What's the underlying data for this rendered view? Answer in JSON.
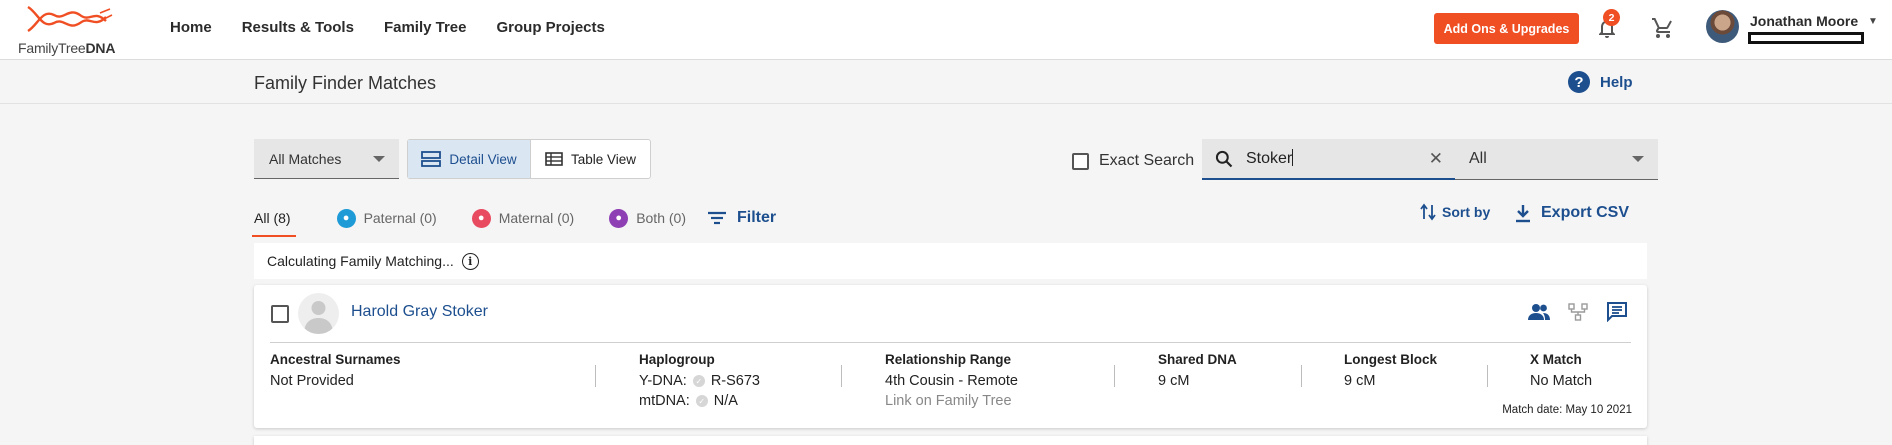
{
  "brand": {
    "name_light": "FamilyTree",
    "name_bold": "DNA",
    "accent": "#f04e23",
    "link_color": "#1d4f8f"
  },
  "nav": {
    "items": [
      "Home",
      "Results & Tools",
      "Family Tree",
      "Group Projects"
    ]
  },
  "header": {
    "addons_label": "Add Ons & Upgrades",
    "notifications_count": "2",
    "user_name": "Jonathan Moore"
  },
  "page": {
    "title": "Family Finder Matches",
    "help_label": "Help"
  },
  "toolbar": {
    "matches_select": "All Matches",
    "detail_view": "Detail View",
    "table_view": "Table View",
    "exact_search_label": "Exact Search",
    "search_value": "Stoker",
    "scope_select": "All"
  },
  "tabs": [
    {
      "label": "All (8)"
    },
    {
      "label": "Paternal (0)"
    },
    {
      "label": "Maternal (0)"
    },
    {
      "label": "Both (0)"
    }
  ],
  "filter_label": "Filter",
  "sort_label": "Sort by",
  "export_label": "Export CSV",
  "calc": {
    "text": "Calculating Family Matching..."
  },
  "match": {
    "name": "Harold Gray Stoker",
    "ancestral_surnames_head": "Ancestral Surnames",
    "ancestral_surnames": "Not Provided",
    "haplogroup_head": "Haplogroup",
    "ydna_label": "Y-DNA:",
    "ydna_value": "R-S673",
    "mtdna_label": "mtDNA:",
    "mtdna_value": "N/A",
    "relationship_head": "Relationship Range",
    "relationship": "4th Cousin - Remote",
    "link_tree": "Link on Family Tree",
    "shared_head": "Shared DNA",
    "shared": "9 cM",
    "longest_head": "Longest Block",
    "longest": "9 cM",
    "xmatch_head": "X Match",
    "xmatch": "No Match",
    "match_date": "Match date: May 10 2021"
  }
}
